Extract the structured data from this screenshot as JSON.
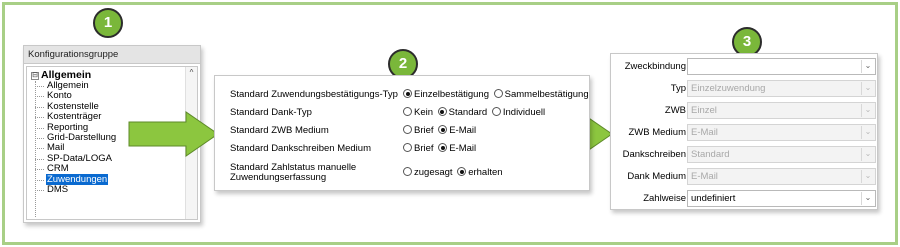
{
  "badges": [
    "1",
    "2",
    "3"
  ],
  "panel1": {
    "header": "Konfigurationsgruppe",
    "root": {
      "expander": "⊟",
      "label": "Allgemein"
    },
    "scroll_up": "^",
    "items": [
      {
        "label": "Allgemein",
        "selected": false
      },
      {
        "label": "Konto",
        "selected": false
      },
      {
        "label": "Kostenstelle",
        "selected": false
      },
      {
        "label": "Kostenträger",
        "selected": false
      },
      {
        "label": "Reporting",
        "selected": false
      },
      {
        "label": "Grid-Darstellung",
        "selected": false
      },
      {
        "label": "Mail",
        "selected": false
      },
      {
        "label": "SP-Data/LOGA",
        "selected": false
      },
      {
        "label": "CRM",
        "selected": false
      },
      {
        "label": "Zuwendungen",
        "selected": true
      },
      {
        "label": "DMS",
        "selected": false
      }
    ]
  },
  "panel2": {
    "rows": [
      {
        "label": "Standard Zuwendungsbestätigungs-Typ",
        "options": [
          {
            "label": "Einzelbestätigung",
            "checked": true
          },
          {
            "label": "Sammelbestätigung",
            "checked": false
          }
        ]
      },
      {
        "label": "Standard Dank-Typ",
        "options": [
          {
            "label": "Kein",
            "checked": false
          },
          {
            "label": "Standard",
            "checked": true
          },
          {
            "label": "Individuell",
            "checked": false
          }
        ]
      },
      {
        "label": "Standard ZWB Medium",
        "options": [
          {
            "label": "Brief",
            "checked": false
          },
          {
            "label": "E-Mail",
            "checked": true
          }
        ]
      },
      {
        "label": "Standard Dankschreiben Medium",
        "options": [
          {
            "label": "Brief",
            "checked": false
          },
          {
            "label": "E-Mail",
            "checked": true
          }
        ]
      },
      {
        "label_line1": "Standard Zahlstatus manuelle",
        "label_line2": "Zuwendungserfassung",
        "options": [
          {
            "label": "zugesagt",
            "checked": false
          },
          {
            "label": "erhalten",
            "checked": true
          }
        ]
      }
    ]
  },
  "panel3": {
    "dropdown_glyph": "⌄",
    "rows": [
      {
        "label": "Zweckbindung",
        "value": "",
        "disabled": false
      },
      {
        "label": "Typ",
        "value": "Einzelzuwendung",
        "disabled": true
      },
      {
        "label": "ZWB",
        "value": "Einzel",
        "disabled": true
      },
      {
        "label": "ZWB Medium",
        "value": "E-Mail",
        "disabled": true
      },
      {
        "label": "Dankschreiben",
        "value": "Standard",
        "disabled": true
      },
      {
        "label": "Dank Medium",
        "value": "E-Mail",
        "disabled": true
      },
      {
        "label": "Zahlweise",
        "value": "undefiniert",
        "disabled": false
      }
    ]
  },
  "colors": {
    "frame_border": "#a8cf86",
    "badge_fill": "#7ab73a",
    "arrow_fill": "#8cc63f",
    "selection": "#0a6ad0"
  }
}
